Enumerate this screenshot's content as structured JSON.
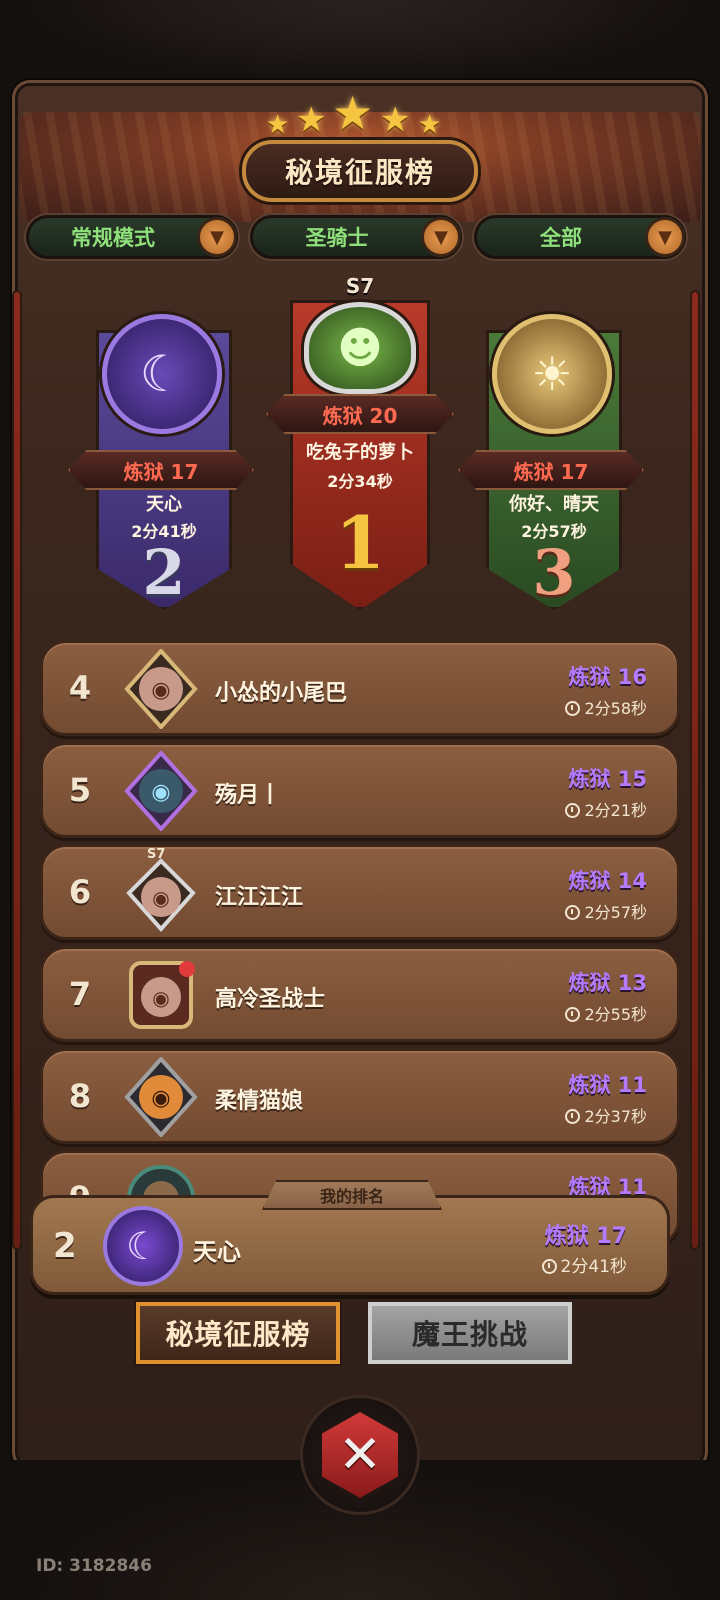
{
  "header": {
    "title": "秘境征服榜",
    "stars": 5
  },
  "filters": [
    {
      "label": "常规模式"
    },
    {
      "label": "圣骑士"
    },
    {
      "label": "全部"
    }
  ],
  "podium": {
    "first": {
      "season": "S7",
      "tier": "炼狱 20",
      "name": "吃兔子的萝卜",
      "time": "2分34秒",
      "rank": "1"
    },
    "second": {
      "tier": "炼狱 17",
      "name": "天心",
      "time": "2分41秒",
      "rank": "2"
    },
    "third": {
      "tier": "炼狱 17",
      "name": "你好、晴天",
      "time": "2分57秒",
      "rank": "3"
    }
  },
  "rows": [
    {
      "rank": "4",
      "name": "小怂的小尾巴",
      "tier": "炼狱 16",
      "time": "2分58秒"
    },
    {
      "rank": "5",
      "name": "殇月丨",
      "tier": "炼狱 15",
      "time": "2分21秒"
    },
    {
      "rank": "6",
      "name": "江江江江",
      "tier": "炼狱 14",
      "time": "2分57秒",
      "avatar_badge": "S7"
    },
    {
      "rank": "7",
      "name": "高冷圣战士",
      "tier": "炼狱 13",
      "time": "2分55秒"
    },
    {
      "rank": "8",
      "name": "柔情猫娘",
      "tier": "炼狱 11",
      "time": "2分37秒"
    },
    {
      "rank": "9",
      "name": "",
      "tier": "炼狱 11",
      "time": ""
    }
  ],
  "my_rank": {
    "tag": "我的排名",
    "rank": "2",
    "name": "天心",
    "tier": "炼狱 17",
    "time": "2分41秒"
  },
  "tabs": {
    "active": "秘境征服榜",
    "inactive": "魔王挑战"
  },
  "footer": {
    "user_id": "ID: 3182846"
  },
  "colors": {
    "tier_purple": "#b47bff",
    "tier_red": "#ff6a50",
    "filter_green": "#8fe07a",
    "accent_gold": "#e0922e"
  }
}
